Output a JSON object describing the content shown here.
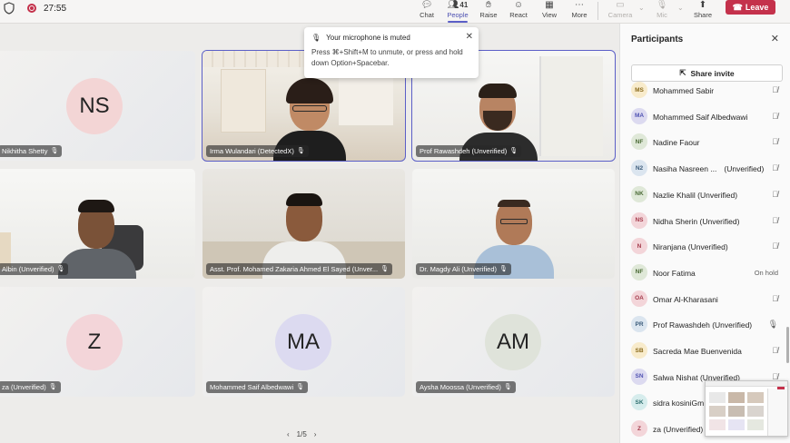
{
  "topbar": {
    "timer": "27:55",
    "buttons": {
      "chat": "Chat",
      "people": "People",
      "people_count": "41",
      "raise": "Raise",
      "react": "React",
      "view": "View",
      "more": "More",
      "camera": "Camera",
      "mic": "Mic",
      "share": "Share",
      "leave": "Leave"
    }
  },
  "toast": {
    "title": "Your microphone is muted",
    "body": "Press ⌘+Shift+M to unmute, or press and hold down Option+Spacebar."
  },
  "tiles": [
    {
      "name": "Nikhitha Shetty",
      "initials": "NS",
      "avatar_color": "#f3d5d5"
    },
    {
      "name": "Irma Wulandari (DetectedX)"
    },
    {
      "name": "Prof Rawashdeh (Unverified)"
    },
    {
      "name": "Albin (Unverified)"
    },
    {
      "name": "Asst. Prof. Mohamed Zakaria Ahmed El Sayed (Unver..."
    },
    {
      "name": "Dr. Magdy Ali (Unverified)"
    },
    {
      "name": "za (Unverified)",
      "initials": "Z",
      "avatar_color": "#f3d5d9"
    },
    {
      "name": "Mohammed Saif Albedwawi",
      "initials": "MA",
      "avatar_color": "#dcdaf0"
    },
    {
      "name": "Aysha Moossa (Unverified)",
      "initials": "AM",
      "avatar_color": "#dfe3da"
    }
  ],
  "pager": {
    "prev": "‹",
    "label": "1/5",
    "next": "›"
  },
  "panel": {
    "title": "Participants",
    "share_invite": "Share invite",
    "participants": [
      {
        "initials": "MS",
        "name": "Mohammed Sabir",
        "status": "🎙̸",
        "bg": "#f8ebcb",
        "fg": "#8a6a1c"
      },
      {
        "initials": "MA",
        "name": "Mohammed Saif Albedwawi",
        "status": "🎙̸",
        "bg": "#dcdaf0",
        "fg": "#4f52b2"
      },
      {
        "initials": "NF",
        "name": "Nadine Faour",
        "status": "🎙̸",
        "bg": "#dfe8d8",
        "fg": "#4a6a35"
      },
      {
        "initials": "N2",
        "name": "Nasiha Nasreen ...",
        "suffix": "(Unverified)",
        "status": "🎙̸",
        "bg": "#dbe5ef",
        "fg": "#3b5b7a"
      },
      {
        "initials": "NK",
        "name": "Nazlie Khalil (Unverified)",
        "status": "🎙̸",
        "bg": "#dfe8d8",
        "fg": "#4a6a35"
      },
      {
        "initials": "NS",
        "name": "Nidha Sherin (Unverified)",
        "status": "🎙̸",
        "bg": "#f3d5d9",
        "fg": "#a33a4a"
      },
      {
        "initials": "N",
        "name": "Niranjana (Unverified)",
        "status": "🎙̸",
        "bg": "#f3d5d9",
        "fg": "#a33a4a"
      },
      {
        "initials": "NF",
        "name": "Noor Fatima",
        "status": "On hold",
        "bg": "#dfe8d8",
        "fg": "#4a6a35"
      },
      {
        "initials": "OA",
        "name": "Omar Al-Kharasani",
        "status": "🎙̸",
        "bg": "#f3d5d9",
        "fg": "#a33a4a"
      },
      {
        "initials": "PR",
        "name": "Prof Rawashdeh (Unverified)",
        "status": "🎙",
        "bg": "#dbe5ef",
        "fg": "#3b5b7a"
      },
      {
        "initials": "SB",
        "name": "Sacreda Mae Buenvenida",
        "status": "🎙̸",
        "bg": "#f8ebcb",
        "fg": "#8a6a1c"
      },
      {
        "initials": "SN",
        "name": "Salwa Nishat (Unverified)",
        "status": "🎙̸",
        "bg": "#dcdaf0",
        "fg": "#4f52b2"
      },
      {
        "initials": "SK",
        "name": "sidra kosiniGm...",
        "status": "",
        "bg": "#d6ecec",
        "fg": "#2f6f6f"
      },
      {
        "initials": "Z",
        "name": "za (Unverified)",
        "status": "",
        "bg": "#f3d5d9",
        "fg": "#a33a4a"
      }
    ]
  },
  "colors": {
    "accent": "#5b5fc7",
    "leave": "#c4314b",
    "record": "#c4314b"
  }
}
